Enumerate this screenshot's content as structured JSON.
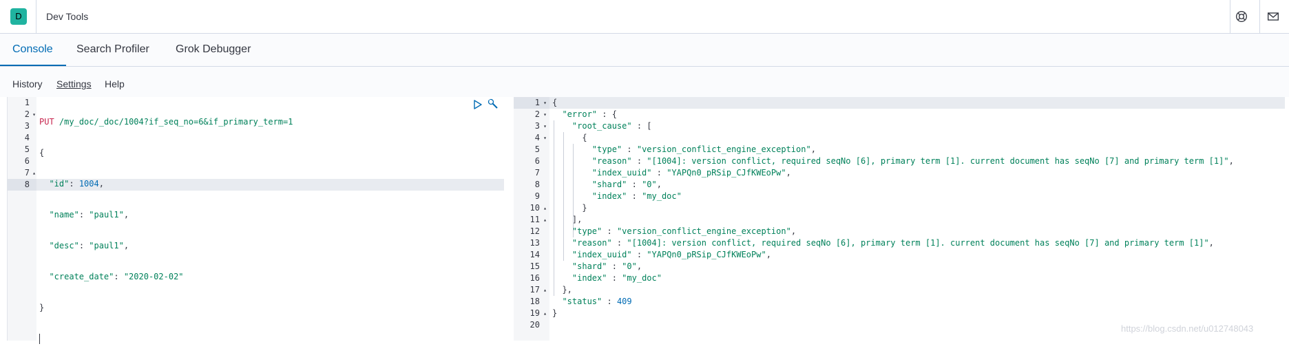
{
  "header": {
    "logo_letter": "D",
    "app_title": "Dev Tools",
    "icons": [
      "help-icon",
      "mail-icon"
    ]
  },
  "tabs": [
    {
      "label": "Console",
      "active": true
    },
    {
      "label": "Search Profiler",
      "active": false
    },
    {
      "label": "Grok Debugger",
      "active": false
    }
  ],
  "submenu": {
    "history": "History",
    "settings": "Settings",
    "help": "Help"
  },
  "request": {
    "lines": [
      "1",
      "2",
      "3",
      "4",
      "5",
      "6",
      "7",
      "8"
    ],
    "method": "PUT",
    "url": "/my_doc/_doc/1004?if_seq_no=6&if_primary_term=1",
    "open_brace": "{",
    "close_brace": "}",
    "fields": [
      {
        "key": "\"id\"",
        "value": "1004",
        "type": "num",
        "trail": ","
      },
      {
        "key": "\"name\"",
        "value": "\"paul1\"",
        "type": "str",
        "trail": ","
      },
      {
        "key": "\"desc\"",
        "value": "\"paul1\"",
        "type": "str",
        "trail": ","
      },
      {
        "key": "\"create_date\"",
        "value": "\"2020-02-02\"",
        "type": "str",
        "trail": ""
      }
    ]
  },
  "response": {
    "lines": [
      "1",
      "2",
      "3",
      "4",
      "5",
      "6",
      "7",
      "8",
      "9",
      "10",
      "11",
      "12",
      "13",
      "14",
      "15",
      "16",
      "17",
      "18",
      "19",
      "20"
    ],
    "rows": [
      {
        "indent": 0,
        "parts": [
          [
            "p",
            "{"
          ]
        ]
      },
      {
        "indent": 1,
        "parts": [
          [
            "k",
            "\"error\""
          ],
          [
            "p",
            " : {"
          ]
        ]
      },
      {
        "indent": 2,
        "parts": [
          [
            "k",
            "\"root_cause\""
          ],
          [
            "p",
            " : ["
          ]
        ]
      },
      {
        "indent": 3,
        "parts": [
          [
            "p",
            "{"
          ]
        ]
      },
      {
        "indent": 4,
        "parts": [
          [
            "k",
            "\"type\""
          ],
          [
            "p",
            " : "
          ],
          [
            "s",
            "\"version_conflict_engine_exception\""
          ],
          [
            "p",
            ","
          ]
        ]
      },
      {
        "indent": 4,
        "parts": [
          [
            "k",
            "\"reason\""
          ],
          [
            "p",
            " : "
          ],
          [
            "s",
            "\"[1004]: version conflict, required seqNo [6], primary term [1]. current document has seqNo [7] and primary term [1]\""
          ],
          [
            "p",
            ","
          ]
        ]
      },
      {
        "indent": 4,
        "parts": [
          [
            "k",
            "\"index_uuid\""
          ],
          [
            "p",
            " : "
          ],
          [
            "s",
            "\"YAPQn0_pRSip_CJfKWEoPw\""
          ],
          [
            "p",
            ","
          ]
        ]
      },
      {
        "indent": 4,
        "parts": [
          [
            "k",
            "\"shard\""
          ],
          [
            "p",
            " : "
          ],
          [
            "s",
            "\"0\""
          ],
          [
            "p",
            ","
          ]
        ]
      },
      {
        "indent": 4,
        "parts": [
          [
            "k",
            "\"index\""
          ],
          [
            "p",
            " : "
          ],
          [
            "s",
            "\"my_doc\""
          ]
        ]
      },
      {
        "indent": 3,
        "parts": [
          [
            "p",
            "}"
          ]
        ]
      },
      {
        "indent": 2,
        "parts": [
          [
            "p",
            "],"
          ]
        ]
      },
      {
        "indent": 2,
        "parts": [
          [
            "k",
            "\"type\""
          ],
          [
            "p",
            " : "
          ],
          [
            "s",
            "\"version_conflict_engine_exception\""
          ],
          [
            "p",
            ","
          ]
        ]
      },
      {
        "indent": 2,
        "parts": [
          [
            "k",
            "\"reason\""
          ],
          [
            "p",
            " : "
          ],
          [
            "s",
            "\"[1004]: version conflict, required seqNo [6], primary term [1]. current document has seqNo [7] and primary term [1]\""
          ],
          [
            "p",
            ","
          ]
        ]
      },
      {
        "indent": 2,
        "parts": [
          [
            "k",
            "\"index_uuid\""
          ],
          [
            "p",
            " : "
          ],
          [
            "s",
            "\"YAPQn0_pRSip_CJfKWEoPw\""
          ],
          [
            "p",
            ","
          ]
        ]
      },
      {
        "indent": 2,
        "parts": [
          [
            "k",
            "\"shard\""
          ],
          [
            "p",
            " : "
          ],
          [
            "s",
            "\"0\""
          ],
          [
            "p",
            ","
          ]
        ]
      },
      {
        "indent": 2,
        "parts": [
          [
            "k",
            "\"index\""
          ],
          [
            "p",
            " : "
          ],
          [
            "s",
            "\"my_doc\""
          ]
        ]
      },
      {
        "indent": 1,
        "parts": [
          [
            "p",
            "},"
          ]
        ]
      },
      {
        "indent": 1,
        "parts": [
          [
            "k",
            "\"status\""
          ],
          [
            "p",
            " : "
          ],
          [
            "n",
            "409"
          ]
        ]
      },
      {
        "indent": 0,
        "parts": [
          [
            "p",
            "}"
          ]
        ]
      },
      {
        "indent": 0,
        "parts": []
      }
    ]
  },
  "watermark": "https://blog.csdn.net/u012748043"
}
